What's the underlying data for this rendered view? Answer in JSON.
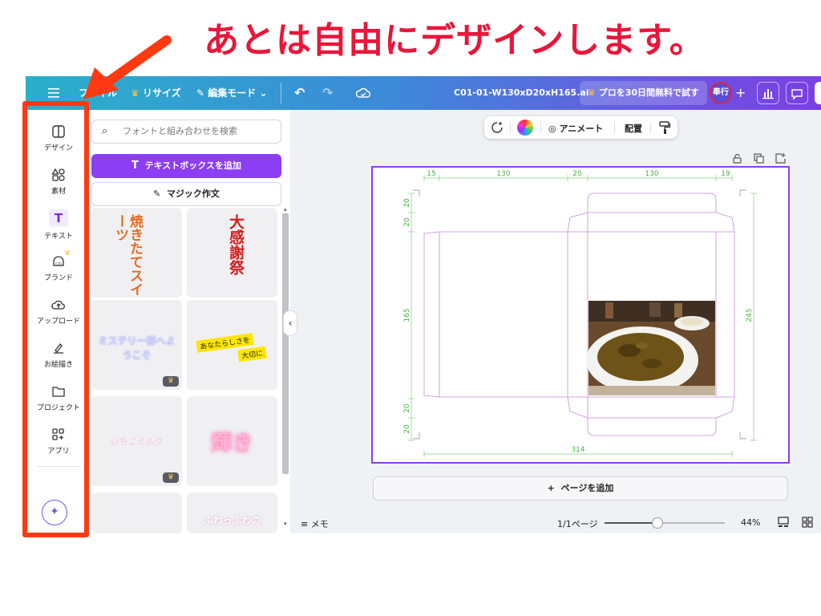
{
  "caption": "あとは自由にデザインします。",
  "topbar": {
    "file": "ファイル",
    "resize": "リサイズ",
    "edit_mode": "編集モード",
    "filename": "C01-01-W130xD20xH165.ai",
    "pro_trial": "プロを30日間無料で試す",
    "avatar": "奉行"
  },
  "rail": {
    "items": [
      "デザイン",
      "素材",
      "テキスト",
      "ブランド",
      "アップロード",
      "お絵描き",
      "プロジェクト",
      "アプリ"
    ]
  },
  "panel": {
    "search_placeholder": "フォントと組み合わせを検索",
    "add_textbox": "テキストボックスを追加",
    "magic_write": "マジック作文",
    "samples": [
      "焼きたてスイーツ",
      "大感謝祭",
      "ミステリー部へようこそ",
      "あなたらしさを",
      "大切に",
      "いちごミルク",
      "輝き",
      "ふわっふわの"
    ]
  },
  "context_toolbar": {
    "animate": "アニメート",
    "position": "配置"
  },
  "dimensions": {
    "top": [
      "15",
      "130",
      "20",
      "130",
      "19"
    ],
    "left_top": [
      "20",
      "20"
    ],
    "left_mid": "165",
    "left_bottom": [
      "20",
      "20"
    ],
    "right": "245",
    "bottom": "314"
  },
  "bottom": {
    "add_page": "ページを追加",
    "notes": "メモ",
    "page_count": "1/1ページ",
    "zoom": "44%"
  },
  "zoom_level": 0.44,
  "colors": {
    "caption": "#e8163a",
    "accent": "#8b3ef3",
    "highlight": "#ff3a12"
  }
}
